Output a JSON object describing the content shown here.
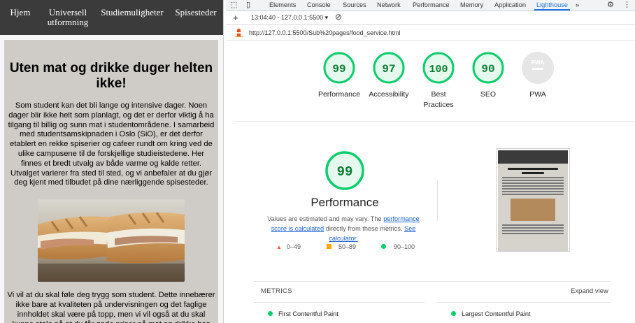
{
  "site": {
    "nav": [
      "Hjem",
      "Universell utformning",
      "Studiemuligheter",
      "Spisesteder"
    ],
    "heading": "Uten mat og drikke duger helten ikke!",
    "intro": "Som student kan det bli lange og intensive dager. Noen dager blir ikke helt som planlagt, og det er derfor viktig å ha tilgang til billig og sunn mat i studentområdene. I samarbeid med studentsamskipnaden i Oslo (SiO), er det derfor etablert en rekke spiserier og cafeer rundt om kring ved de ulike campusene til de forskjellige studieistedene. Her finnes et bredt utvalg av både varme og kalde retter. Utvalget varierer fra sted til sted, og vi anbefaler at du gjør deg kjent med tilbudet på dine nærliggende spisesteder.",
    "para2": "Vi vil at du skal føle deg trygg som student. Dette innebærer ikke bare at kvaliteten på undervisningen og det faglige innholdet skal være på topp, men vi vil også at du skal kunne stole på at du får gode priser på mat og drikke hos oss."
  },
  "devtools": {
    "tabs": [
      "Elements",
      "Console",
      "Sources",
      "Network",
      "Performance",
      "Memory",
      "Application",
      "Lighthouse"
    ],
    "more": "»",
    "report_time": "13:04:40 - 127.0.0.1:5500 ▾",
    "url": "http://127.0.0.1:5500/Sub%20pages/food_service.html",
    "scores": [
      {
        "value": "99",
        "label": "Performance"
      },
      {
        "value": "97",
        "label": "Accessibility"
      },
      {
        "value": "100",
        "label": "Best Practices"
      },
      {
        "value": "90",
        "label": "SEO"
      },
      {
        "value": "",
        "label": "PWA",
        "badge": "PWA"
      }
    ],
    "perf_score": "99",
    "perf_title": "Performance",
    "perf_note_1": "Values are estimated and may vary. The",
    "perf_link_1": "performance score is calculated",
    "perf_note_2": "directly from these metrics.",
    "perf_link_2": "See calculator.",
    "legend": [
      "0–49",
      "50–89",
      "90–100"
    ],
    "metrics_header": "METRICS",
    "expand_label": "Expand view",
    "metrics": [
      "First Contentful Paint",
      "Largest Contentful Paint"
    ]
  },
  "colors": {
    "pass": "#0cce6b",
    "pass_text": "#0c7d33",
    "average": "#ffa400",
    "fail": "#ff4e42",
    "nav_bg": "#3b3b3b"
  }
}
